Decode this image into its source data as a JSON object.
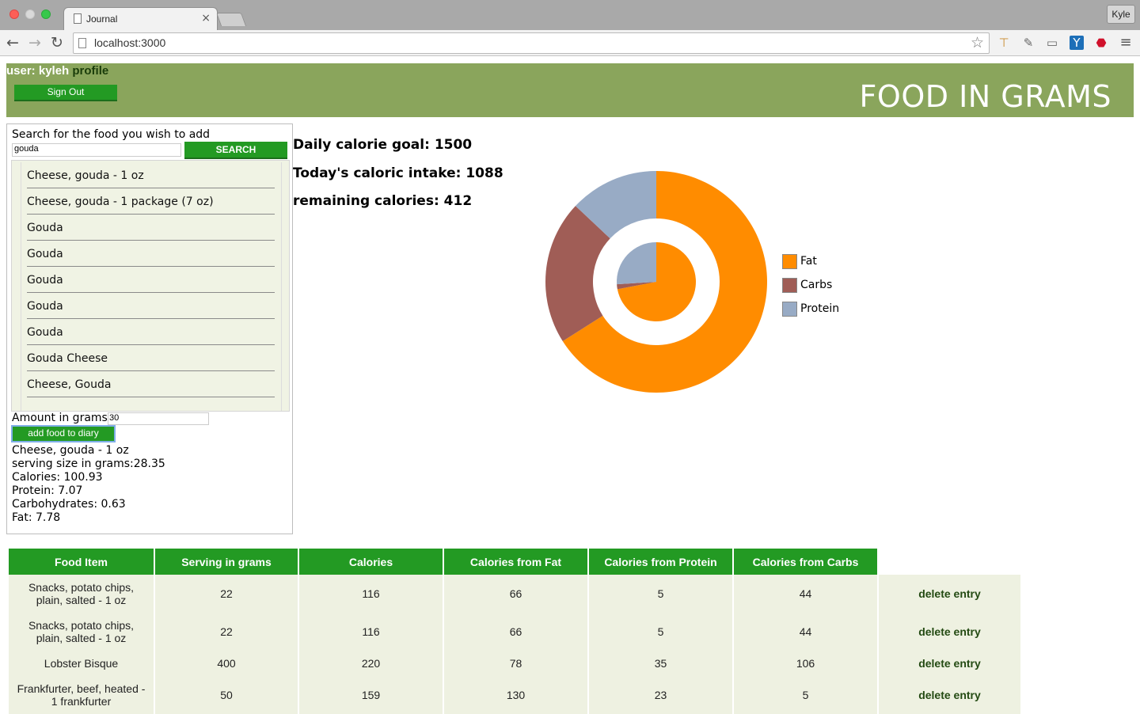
{
  "browser": {
    "tab_title": "Journal",
    "tab_close": "×",
    "url": "localhost:3000",
    "profile_button": "Kyle",
    "back": "←",
    "forward": "→",
    "reload": "↻",
    "star": "☆",
    "menu": "≡"
  },
  "header": {
    "user_prefix": "user: ",
    "username": "kyleh",
    "profile_link": "profile",
    "sign_out": "Sign Out",
    "brand": "FOOD IN GRAMS"
  },
  "search": {
    "label": "Search for the food you wish to add",
    "value": "gouda",
    "button": "SEARCH",
    "results": [
      "Cheese, gouda - 1 oz",
      "Cheese, gouda - 1 package (7 oz)",
      "Gouda",
      "Gouda",
      "Gouda",
      "Gouda",
      "Gouda",
      "Gouda Cheese",
      "Cheese, Gouda"
    ]
  },
  "amount": {
    "label": "Amount in grams",
    "value": "30",
    "add_button": "add food to diary"
  },
  "selected_food": {
    "name": "Cheese, gouda - 1 oz",
    "serving": "serving size in grams:28.35",
    "calories": "Calories: 100.93",
    "protein": "Protein: 7.07",
    "carbs": "Carbohydrates: 0.63",
    "fat": "Fat: 7.78"
  },
  "stats": {
    "goal": "Daily calorie goal: 1500",
    "intake": "Today's caloric intake: 1088",
    "remaining": "remaining calories: 412"
  },
  "chart_data": {
    "type": "pie",
    "legend_position": "right",
    "series": [
      {
        "ring": "outer",
        "values": [
          {
            "label": "Fat",
            "value": 0.66,
            "color": "#ff8c00"
          },
          {
            "label": "Carbs",
            "value": 0.21,
            "color": "#a05d56"
          },
          {
            "label": "Protein",
            "value": 0.13,
            "color": "#98abc5"
          }
        ]
      },
      {
        "ring": "inner",
        "values": [
          {
            "label": "Fat",
            "value": 0.72,
            "color": "#ff8c00"
          },
          {
            "label": "Carbs",
            "value": 0.02,
            "color": "#a05d56"
          },
          {
            "label": "Protein",
            "value": 0.26,
            "color": "#98abc5"
          }
        ]
      }
    ],
    "legend": [
      {
        "label": "Fat",
        "color": "#ff8c00"
      },
      {
        "label": "Carbs",
        "color": "#a05d56"
      },
      {
        "label": "Protein",
        "color": "#98abc5"
      }
    ]
  },
  "table": {
    "headers": [
      "Food Item",
      "Serving in grams",
      "Calories",
      "Calories from Fat",
      "Calories from Protein",
      "Calories from Carbs"
    ],
    "delete_label": "delete entry",
    "rows": [
      {
        "food": "Snacks, potato chips, plain, salted - 1 oz",
        "serving": "22",
        "calories": "116",
        "fat": "66",
        "protein": "5",
        "carbs": "44"
      },
      {
        "food": "Snacks, potato chips, plain, salted - 1 oz",
        "serving": "22",
        "calories": "116",
        "fat": "66",
        "protein": "5",
        "carbs": "44"
      },
      {
        "food": "Lobster Bisque",
        "serving": "400",
        "calories": "220",
        "fat": "78",
        "protein": "35",
        "carbs": "106"
      },
      {
        "food": "Frankfurter, beef, heated - 1 frankfurter",
        "serving": "50",
        "calories": "159",
        "fat": "130",
        "protein": "23",
        "carbs": "5"
      }
    ]
  }
}
